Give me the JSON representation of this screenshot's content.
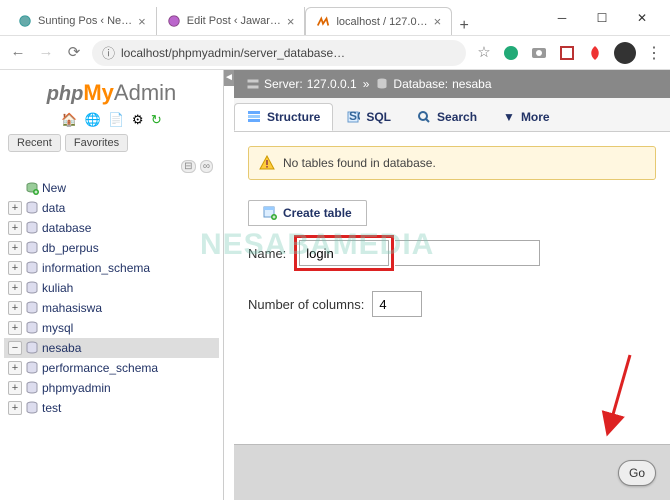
{
  "window": {
    "tabs": [
      {
        "title": "Sunting Pos ‹ Ne…",
        "active": false
      },
      {
        "title": "Edit Post ‹ Jawar…",
        "active": false
      },
      {
        "title": "localhost / 127.0…",
        "active": true
      }
    ],
    "address": "localhost/phpmyadmin/server_database…"
  },
  "sidebar": {
    "tabs": [
      "Recent",
      "Favorites"
    ],
    "new_label": "New",
    "databases": [
      "data",
      "database",
      "db_perpus",
      "information_schema",
      "kuliah",
      "mahasiswa",
      "mysql",
      "nesaba",
      "performance_schema",
      "phpmyadmin",
      "test"
    ],
    "selected": "nesaba"
  },
  "breadcrumb": {
    "server_label": "Server:",
    "server_value": "127.0.0.1",
    "sep": "»",
    "db_label": "Database:",
    "db_value": "nesaba"
  },
  "content_tabs": [
    {
      "label": "Structure",
      "active": true
    },
    {
      "label": "SQL",
      "active": false
    },
    {
      "label": "Search",
      "active": false
    },
    {
      "label": "More",
      "active": false,
      "dropdown": true
    }
  ],
  "warning_text": "No tables found in database.",
  "create_table": {
    "legend": "Create table",
    "name_label": "Name:",
    "name_value": "login",
    "cols_label": "Number of columns:",
    "cols_value": "4",
    "go_label": "Go"
  },
  "watermark": "NESABAMEDIA"
}
